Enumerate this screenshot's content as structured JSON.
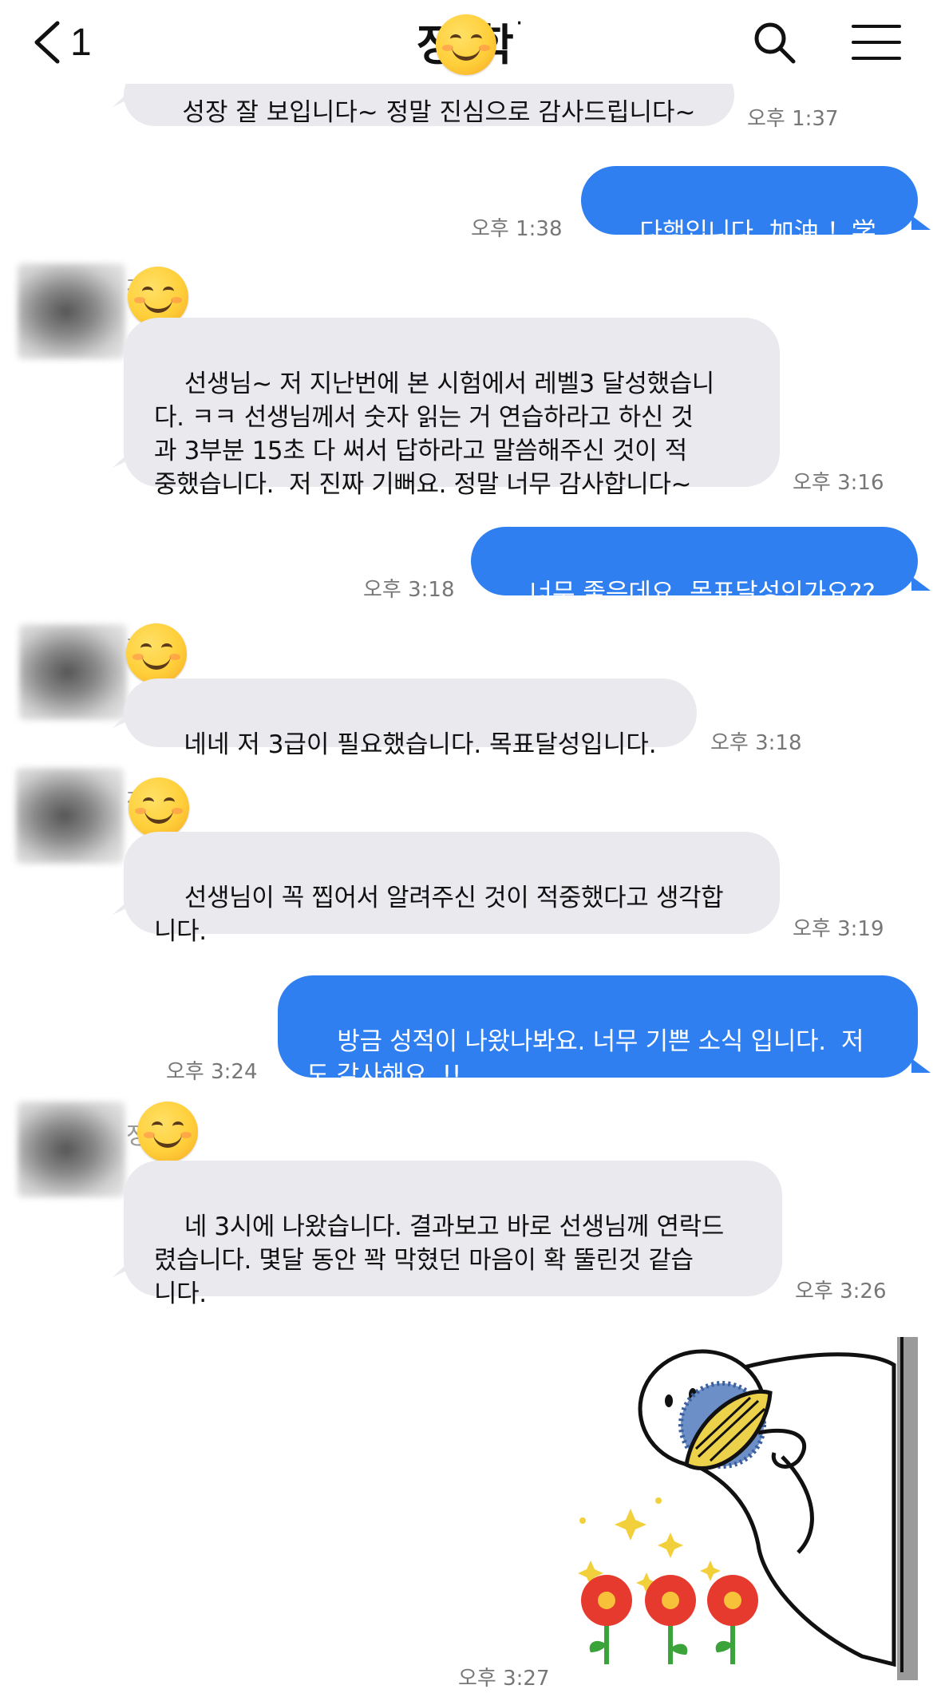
{
  "header": {
    "back_count": "1",
    "title": "정 학",
    "title_suffix": "·"
  },
  "messages": [
    {
      "id": "m0",
      "side": "in",
      "text": "성장 잘 보입니다~ 정말 진심으로 감사드립니다~",
      "time": "오후 1:37"
    },
    {
      "id": "m1",
      "side": "out",
      "text": "다행입니다. 加油 ！学生",
      "time": "오후 1:38"
    },
    {
      "id": "m2",
      "side": "in",
      "sender": "정 학",
      "text": "선생님~ 저 지난번에 본 시험에서 레벨3 달성했습니\n다. ㅋㅋ 선생님께서 숫자 읽는 거 연습하라고 하신 것\n과 3부분 15초 다 써서 답하라고 말씀해주신 것이 적\n중했습니다.  저 진짜 기뻐요. 정말 너무 감사합니다~",
      "time": "오후 3:16"
    },
    {
      "id": "m3",
      "side": "out",
      "text": "너무 좋은데요. 목표달성인가요??",
      "time": "오후 3:18"
    },
    {
      "id": "m4",
      "side": "in",
      "sender": "정 학",
      "text": "네네 저 3급이 필요했습니다. 목표달성입니다.",
      "time": "오후 3:18"
    },
    {
      "id": "m5",
      "side": "in",
      "sender": "정 학",
      "text": "선생님이 꼭 찝어서 알려주신 것이 적중했다고 생각합\n니다.",
      "time": "오후 3:19"
    },
    {
      "id": "m6",
      "side": "out",
      "text": "방금 성적이 나왔나봐요. 너무 기쁜 소식 입니다.  저\n도 감사해요. !!",
      "time": "오후 3:24"
    },
    {
      "id": "m7",
      "side": "in",
      "sender": "정 학",
      "text": "네 3시에 나왔습니다. 결과보고 바로 선생님께 연락드\n렸습니다. 몇달 동안 꽉 막혔던 마음이 확 뚤린것 같습\n니다.",
      "time": "오후 3:26"
    },
    {
      "id": "m8",
      "side": "out",
      "sticker": "peeking-flower-sticker",
      "time": "오후 3:27"
    }
  ],
  "icons": {
    "back": "chevron-left-icon",
    "search": "search-icon",
    "menu": "hamburger-menu-icon",
    "privacy_mask": "smiley-emoji-icon"
  },
  "colors": {
    "out_bubble": "#2f7ff0",
    "in_bubble": "#e9e9ee",
    "timestamp": "#777777"
  }
}
